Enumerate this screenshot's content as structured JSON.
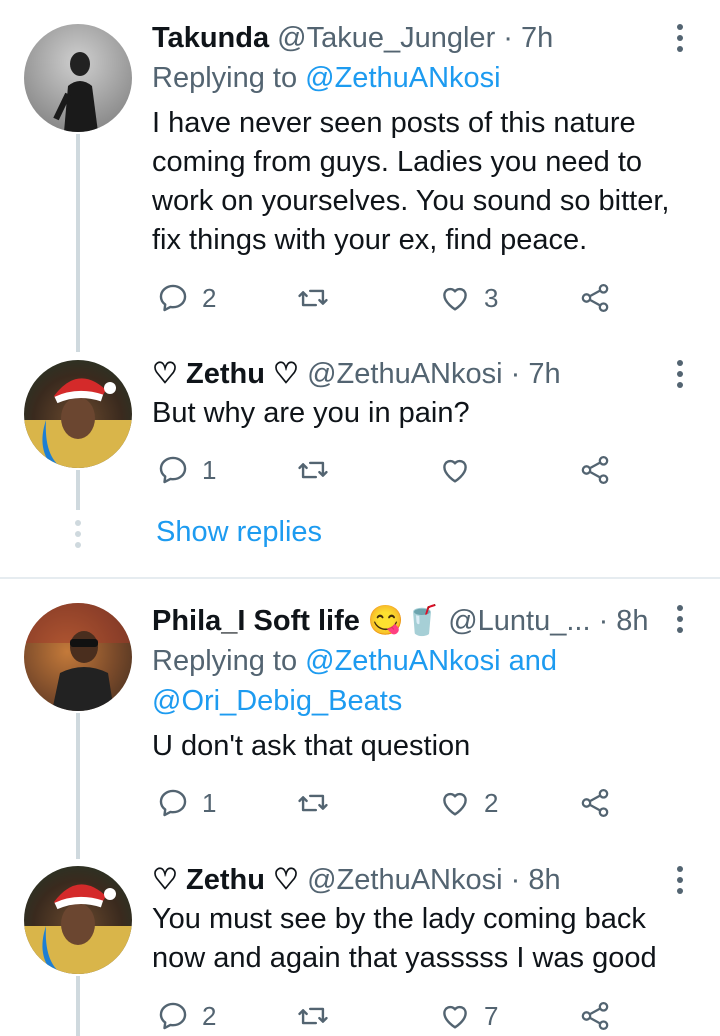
{
  "tweets": [
    {
      "name": "Takunda",
      "handle": "@Takue_Jungler",
      "time": "· 7h",
      "replying_prefix": "Replying to",
      "replying_to": "@ZethuANkosi",
      "text_lines": [
        "I have never seen posts of this nature",
        "coming from guys. Ladies you need to",
        "work on yourselves. You sound so bitter,",
        "fix things with your ex, find peace."
      ],
      "replies": "2",
      "retweets": "",
      "likes": "3"
    },
    {
      "name": "♡ Zethu ♡",
      "handle": "@ZethuANkosi",
      "time": "· 7h",
      "text_lines": [
        "But why are you in pain?"
      ],
      "replies": "1",
      "retweets": "",
      "likes": ""
    },
    {
      "name": "Phila_I Soft life 😋🥤",
      "handle": "@Luntu_...",
      "time": "· 8h",
      "replying_prefix": "Replying to",
      "replying_to": "@ZethuANkosi and",
      "replying_to_2": "@Ori_Debig_Beats",
      "text_lines": [
        "U don't ask that question"
      ],
      "replies": "1",
      "retweets": "",
      "likes": "2"
    },
    {
      "name": "♡ Zethu ♡",
      "handle": "@ZethuANkosi",
      "time": "· 8h",
      "text_lines": [
        "You must see by the lady coming back",
        "now and again that yasssss  I was good"
      ],
      "replies": "2",
      "retweets": "",
      "likes": "7"
    }
  ],
  "show_replies_label": "Show replies",
  "icons": {
    "reply": "reply-icon",
    "retweet": "retweet-icon",
    "like": "heart-icon",
    "share": "share-icon",
    "more": "more-vertical-icon"
  },
  "colors": {
    "link": "#1d9bf0",
    "secondary": "#536471",
    "text": "#0f1419",
    "thread_line": "#cfd9de"
  }
}
